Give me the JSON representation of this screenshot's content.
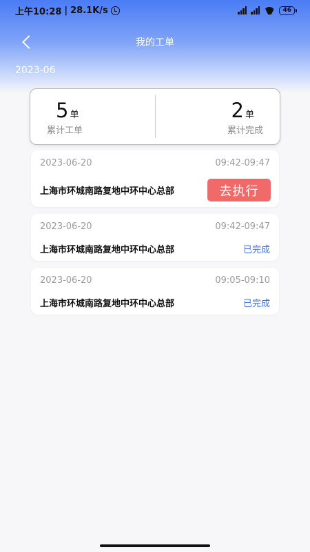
{
  "status_bar": {
    "time": "上午10:28",
    "speed": "28.1K/s",
    "battery": "46"
  },
  "header": {
    "title": "我的工单",
    "month": "2023-06"
  },
  "summary": {
    "total_value": "5",
    "total_unit": "单",
    "total_label": "累计工单",
    "done_value": "2",
    "done_unit": "单",
    "done_label": "累计完成"
  },
  "orders": [
    {
      "date": "2023-06-20",
      "time": "09:42-09:47",
      "address": "上海市环城南路复地中环中心总部",
      "action_label": "去执行"
    },
    {
      "date": "2023-06-20",
      "time": "09:42-09:47",
      "address": "上海市环城南路复地中环中心总部",
      "status": "已完成"
    },
    {
      "date": "2023-06-20",
      "time": "09:05-09:10",
      "address": "上海市环城南路复地中环中心总部",
      "status": "已完成"
    }
  ],
  "colors": {
    "accent_blue": "#4a7cf6",
    "execute_red": "#f06a6a",
    "done_blue": "#3f72e8"
  }
}
